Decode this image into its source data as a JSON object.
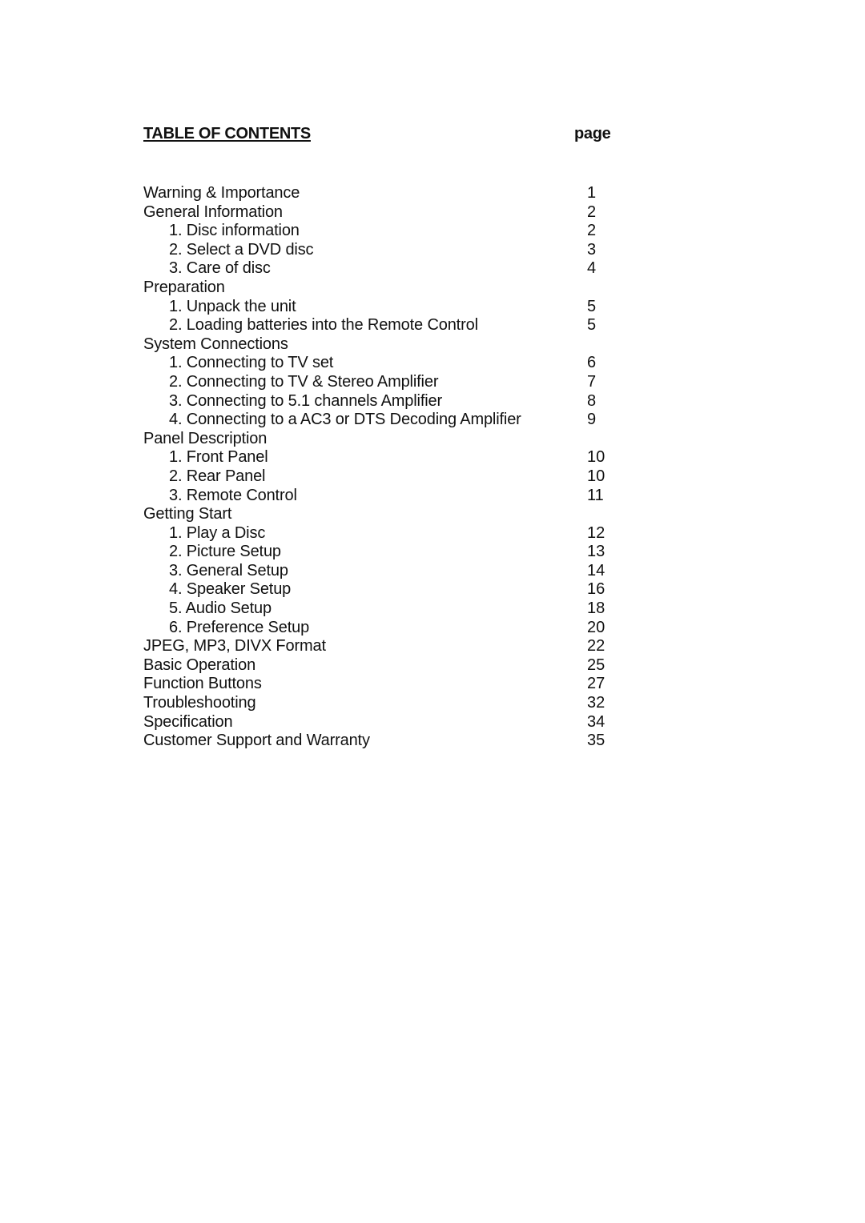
{
  "header": {
    "title": "TABLE OF CONTENTS",
    "page_column_label": "page"
  },
  "entries": [
    {
      "label": "Warning & Importance",
      "page": "1",
      "level": 1
    },
    {
      "label": "General Information",
      "page": "2",
      "level": 1
    },
    {
      "label": "1. Disc information",
      "page": "2",
      "level": 2
    },
    {
      "label": "2. Select a DVD disc",
      "page": "3",
      "level": 2
    },
    {
      "label": "3. Care of disc",
      "page": "4",
      "level": 2
    },
    {
      "label": "Preparation",
      "page": "",
      "level": 1
    },
    {
      "label": "1. Unpack the unit",
      "page": "5",
      "level": 2
    },
    {
      "label": "2. Loading batteries into the Remote Control",
      "page": "5",
      "level": 2
    },
    {
      "label": "System Connections",
      "page": "",
      "level": 1
    },
    {
      "label": "1. Connecting to TV set",
      "page": "6",
      "level": 2
    },
    {
      "label": "2. Connecting to TV & Stereo Amplifier",
      "page": "7",
      "level": 2
    },
    {
      "label": "3. Connecting to 5.1 channels Amplifier",
      "page": "8",
      "level": 2
    },
    {
      "label": "4. Connecting to a AC3 or DTS Decoding Amplifier",
      "page": "9",
      "level": 2
    },
    {
      "label": "Panel Description",
      "page": "",
      "level": 1
    },
    {
      "label": "1. Front Panel",
      "page": "10",
      "level": 2
    },
    {
      "label": "2. Rear Panel",
      "page": "10",
      "level": 2
    },
    {
      "label": "3. Remote Control",
      "page": "11",
      "level": 2
    },
    {
      "label": "Getting Start",
      "page": "",
      "level": 1
    },
    {
      "label": "1. Play a Disc",
      "page": "12",
      "level": 2
    },
    {
      "label": "2. Picture Setup",
      "page": "13",
      "level": 2
    },
    {
      "label": "3. General Setup",
      "page": "14",
      "level": 2
    },
    {
      "label": "4. Speaker Setup",
      "page": "16",
      "level": 2
    },
    {
      "label": "5. Audio Setup",
      "page": "18",
      "level": 2
    },
    {
      "label": "6. Preference Setup",
      "page": "20",
      "level": 2
    },
    {
      "label": "JPEG, MP3, DIVX Format",
      "page": "22",
      "level": 1
    },
    {
      "label": "Basic Operation",
      "page": "25",
      "level": 1
    },
    {
      "label": "Function Buttons",
      "page": "27",
      "level": 1
    },
    {
      "label": "Troubleshooting",
      "page": "32",
      "level": 1
    },
    {
      "label": "Specification",
      "page": "34",
      "level": 1
    },
    {
      "label": "Customer Support and Warranty",
      "page": "35",
      "level": 1
    }
  ]
}
